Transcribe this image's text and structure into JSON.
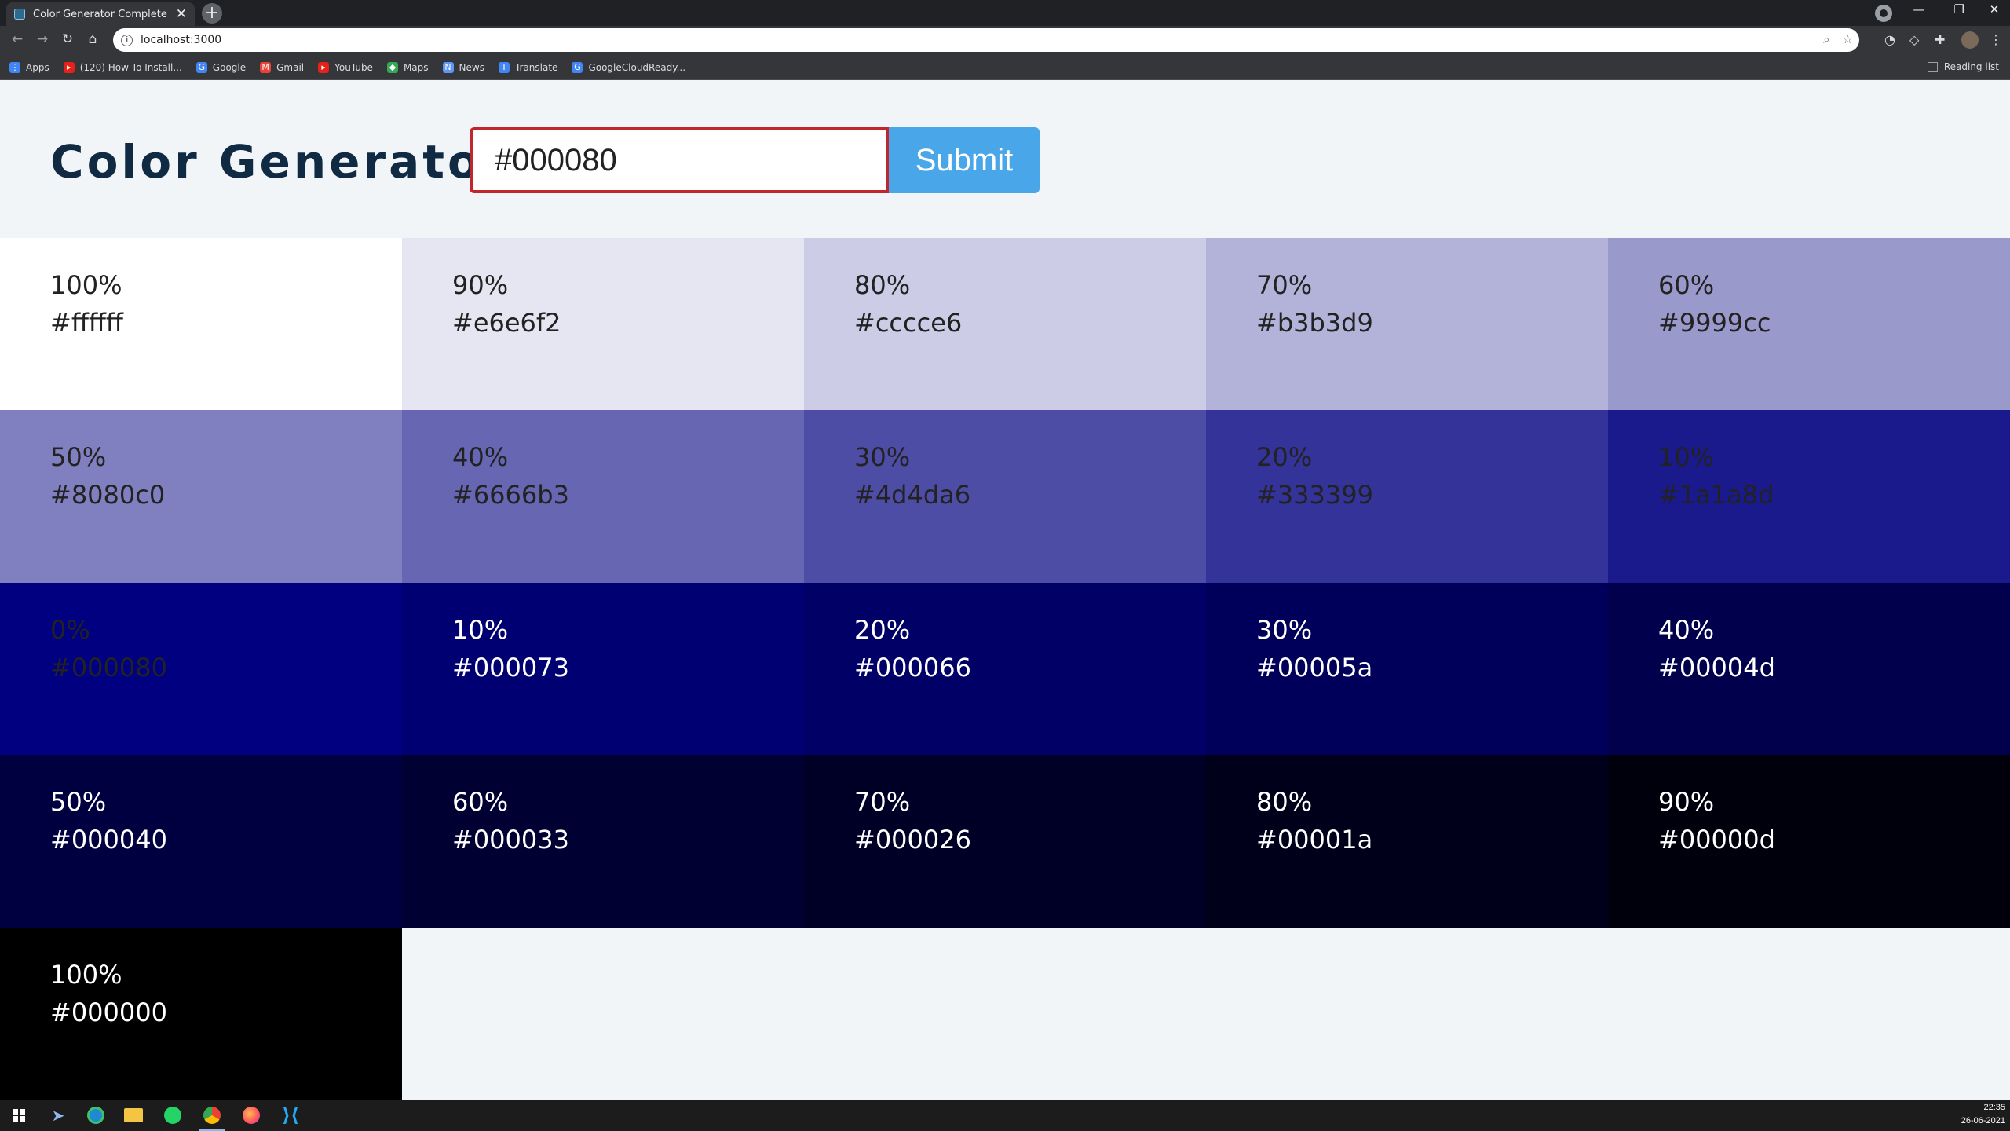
{
  "browser": {
    "tab_title": "Color Generator Complete",
    "tab_close": "✕",
    "new_tab": "+",
    "url": "localhost:3000",
    "reading_list": "Reading list",
    "window_controls": [
      "—",
      "❐",
      "✕"
    ],
    "bookmarks": [
      {
        "label": "Apps",
        "icon": "apps-grid-icon",
        "color": "#4285f4"
      },
      {
        "label": "(120) How To Install...",
        "icon": "youtube-icon",
        "color": "#e62117"
      },
      {
        "label": "Google",
        "icon": "google-icon",
        "color": "#4285f4"
      },
      {
        "label": "Gmail",
        "icon": "gmail-icon",
        "color": "#ea4335"
      },
      {
        "label": "YouTube",
        "icon": "youtube-icon",
        "color": "#e62117"
      },
      {
        "label": "Maps",
        "icon": "maps-icon",
        "color": "#34a853"
      },
      {
        "label": "News",
        "icon": "news-icon",
        "color": "#5e97f6"
      },
      {
        "label": "Translate",
        "icon": "translate-icon",
        "color": "#4285f4"
      },
      {
        "label": "GoogleCloudReady...",
        "icon": "google-icon",
        "color": "#4285f4"
      }
    ]
  },
  "app": {
    "title": "Color Generator",
    "input_value": "#000080",
    "submit_label": "Submit"
  },
  "colors": [
    {
      "pct": "100%",
      "hex": "#ffffff",
      "bg": "#ffffff",
      "fg": "#222222"
    },
    {
      "pct": "90%",
      "hex": "#e6e6f2",
      "bg": "#e6e6f2",
      "fg": "#222222"
    },
    {
      "pct": "80%",
      "hex": "#cccce6",
      "bg": "#cccce6",
      "fg": "#222222"
    },
    {
      "pct": "70%",
      "hex": "#b3b3d9",
      "bg": "#b3b3d9",
      "fg": "#222222"
    },
    {
      "pct": "60%",
      "hex": "#9999cc",
      "bg": "#9999cc",
      "fg": "#222222"
    },
    {
      "pct": "50%",
      "hex": "#8080c0",
      "bg": "#8080c0",
      "fg": "#222222"
    },
    {
      "pct": "40%",
      "hex": "#6666b3",
      "bg": "#6666b3",
      "fg": "#222222"
    },
    {
      "pct": "30%",
      "hex": "#4d4da6",
      "bg": "#4d4da6",
      "fg": "#222222"
    },
    {
      "pct": "20%",
      "hex": "#333399",
      "bg": "#333399",
      "fg": "#222222"
    },
    {
      "pct": "10%",
      "hex": "#1a1a8d",
      "bg": "#1a1a8d",
      "fg": "#222222"
    },
    {
      "pct": "0%",
      "hex": "#000080",
      "bg": "#000080",
      "fg": "#222222"
    },
    {
      "pct": "10%",
      "hex": "#000073",
      "bg": "#000073",
      "fg": "#ffffff"
    },
    {
      "pct": "20%",
      "hex": "#000066",
      "bg": "#000066",
      "fg": "#ffffff"
    },
    {
      "pct": "30%",
      "hex": "#00005a",
      "bg": "#00005a",
      "fg": "#ffffff"
    },
    {
      "pct": "40%",
      "hex": "#00004d",
      "bg": "#00004d",
      "fg": "#ffffff"
    },
    {
      "pct": "50%",
      "hex": "#000040",
      "bg": "#000040",
      "fg": "#ffffff"
    },
    {
      "pct": "60%",
      "hex": "#000033",
      "bg": "#000033",
      "fg": "#ffffff"
    },
    {
      "pct": "70%",
      "hex": "#000026",
      "bg": "#000026",
      "fg": "#ffffff"
    },
    {
      "pct": "80%",
      "hex": "#00001a",
      "bg": "#00001a",
      "fg": "#ffffff"
    },
    {
      "pct": "90%",
      "hex": "#00000d",
      "bg": "#00000d",
      "fg": "#ffffff"
    },
    {
      "pct": "100%",
      "hex": "#000000",
      "bg": "#000000",
      "fg": "#ffffff"
    }
  ],
  "taskbar": {
    "time": "22:35",
    "date": "26-06-2021",
    "apps": [
      {
        "icon": "windows-start-icon"
      },
      {
        "icon": "cortana-icon"
      },
      {
        "icon": "edge-icon"
      },
      {
        "icon": "file-explorer-icon"
      },
      {
        "icon": "whatsapp-icon"
      },
      {
        "icon": "chrome-icon"
      },
      {
        "icon": "firefox-icon"
      },
      {
        "icon": "vscode-icon"
      }
    ]
  }
}
